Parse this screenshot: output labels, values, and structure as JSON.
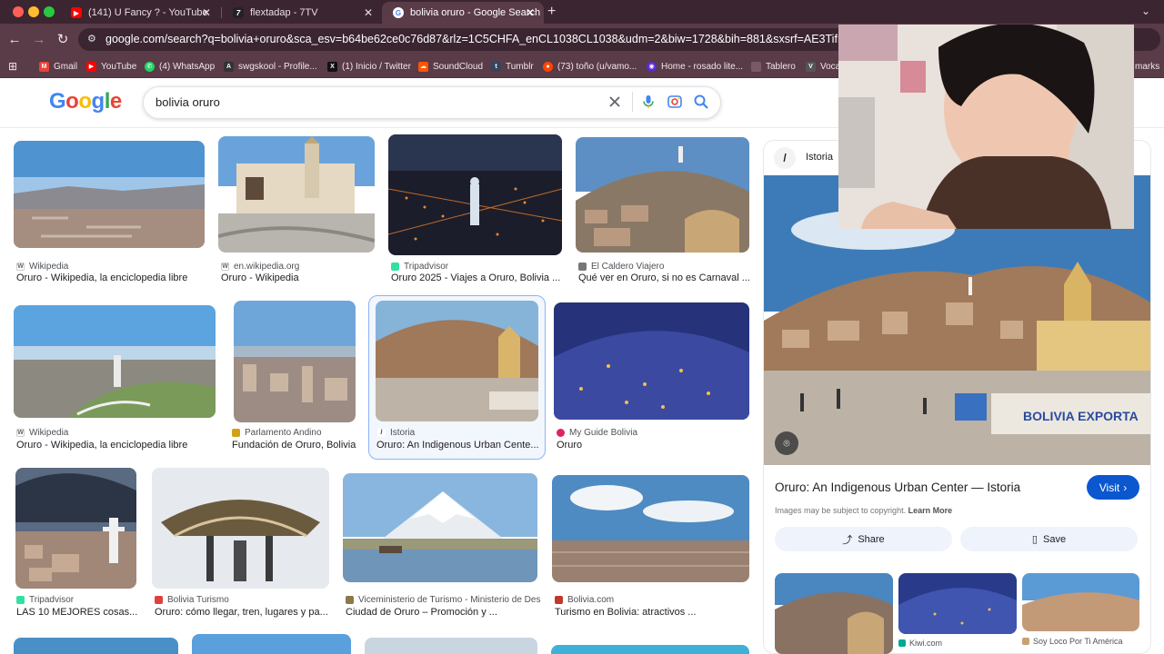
{
  "browser": {
    "tabs": [
      {
        "label": "(141) U Fancy ? - YouTube",
        "favicon": "youtube-icon",
        "color": "#ff0000"
      },
      {
        "label": "flextadap - 7TV",
        "favicon": "7tv-icon",
        "color": "#222222"
      },
      {
        "label": "bolivia oruro - Google Search",
        "favicon": "google-icon",
        "color": "#ffffff"
      }
    ],
    "url": "google.com/search?q=bolivia+oruro&sca_esv=b64be62ce0c76d87&rlz=1C5CHFA_enCL1038CL1038&udm=2&biw=1728&bih=881&sxsrf=AE3TifPyvguOqon4cLagcr",
    "bookmarks": [
      {
        "label": "Gmail",
        "color": "#ea4335",
        "glyph": "M"
      },
      {
        "label": "YouTube",
        "color": "#ff0000",
        "glyph": "▶"
      },
      {
        "label": "(4) WhatsApp",
        "color": "#25d366",
        "glyph": "✆"
      },
      {
        "label": "swgskool - Profile...",
        "color": "#333333",
        "glyph": "A"
      },
      {
        "label": "(1) Inicio / Twitter",
        "color": "#111111",
        "glyph": "X"
      },
      {
        "label": "SoundCloud",
        "color": "#ff5500",
        "glyph": "☁"
      },
      {
        "label": "Tumblr",
        "color": "#35465c",
        "glyph": "t"
      },
      {
        "label": "(73) toño (u/vamo...",
        "color": "#ff4500",
        "glyph": "●"
      },
      {
        "label": "Home - rosado lite...",
        "color": "#5b2bd6",
        "glyph": "◉"
      },
      {
        "label": "Tablero",
        "color": "#5a3b48",
        "glyph": "·"
      },
      {
        "label": "Voca",
        "color": "#555555",
        "glyph": "V"
      },
      {
        "label": "marks",
        "color": "#5a3b48",
        "glyph": ""
      }
    ]
  },
  "search": {
    "query": "bolivia oruro",
    "logo": "Google"
  },
  "results": [
    {
      "source": "Wikipedia",
      "title": "Oruro - Wikipedia, la enciclopedia libre",
      "favicon_color": "#666666",
      "glyph": "W"
    },
    {
      "source": "en.wikipedia.org",
      "title": "Oruro - Wikipedia",
      "favicon_color": "#666666",
      "glyph": "W"
    },
    {
      "source": "Tripadvisor",
      "title": "Oruro 2025 - Viajes a Oruro, Bolivia ...",
      "favicon_color": "#34e0a1",
      "glyph": ""
    },
    {
      "source": "El Caldero Viajero",
      "title": "Qué ver en Oruro, si no es Carnaval ...",
      "favicon_color": "#777777",
      "glyph": ""
    },
    {
      "source": "Wikipedia",
      "title": "Oruro - Wikipedia, la enciclopedia libre",
      "favicon_color": "#666666",
      "glyph": "W"
    },
    {
      "source": "Parlamento Andino",
      "title": "Fundación de Oruro, Bolivia",
      "favicon_color": "#d4a017",
      "glyph": ""
    },
    {
      "source": "Istoria",
      "title": "Oruro: An Indigenous Urban Cente...",
      "favicon_color": "#222222",
      "glyph": "/"
    },
    {
      "source": "My Guide Bolivia",
      "title": "Oruro",
      "favicon_color": "#e0245e",
      "glyph": ""
    },
    {
      "source": "Tripadvisor",
      "title": "LAS 10 MEJORES cosas...",
      "favicon_color": "#34e0a1",
      "glyph": ""
    },
    {
      "source": "Bolivia Turismo",
      "title": "Oruro: cómo llegar, tren, lugares y pa...",
      "favicon_color": "#e04040",
      "glyph": ""
    },
    {
      "source": "Viceministerio de Turismo - Ministerio de Des...",
      "title": "Ciudad de Oruro – Promoción y ...",
      "favicon_color": "#8a7a4a",
      "glyph": ""
    },
    {
      "source": "Bolivia.com",
      "title": "Turismo en Bolivia: atractivos ...",
      "favicon_color": "#c0392b",
      "glyph": "b"
    }
  ],
  "panel": {
    "source": "Istoria",
    "title": "Oruro: An Indigenous Urban Center — Istoria",
    "visit_label": "Visit",
    "copyright": "Images may be subject to copyright.",
    "learn_more": "Learn More",
    "share_label": "Share",
    "save_label": "Save",
    "related": [
      {
        "source": "",
        "title": ""
      },
      {
        "source": "Kiwi.com",
        "title": ""
      },
      {
        "source": "Soy Loco Por Ti América",
        "title": ""
      }
    ]
  },
  "colors": {
    "chrome_dark": "#3b2530",
    "chrome": "#5a3b48",
    "accent": "#0b57d0",
    "selected_border": "#8ab4f8"
  }
}
